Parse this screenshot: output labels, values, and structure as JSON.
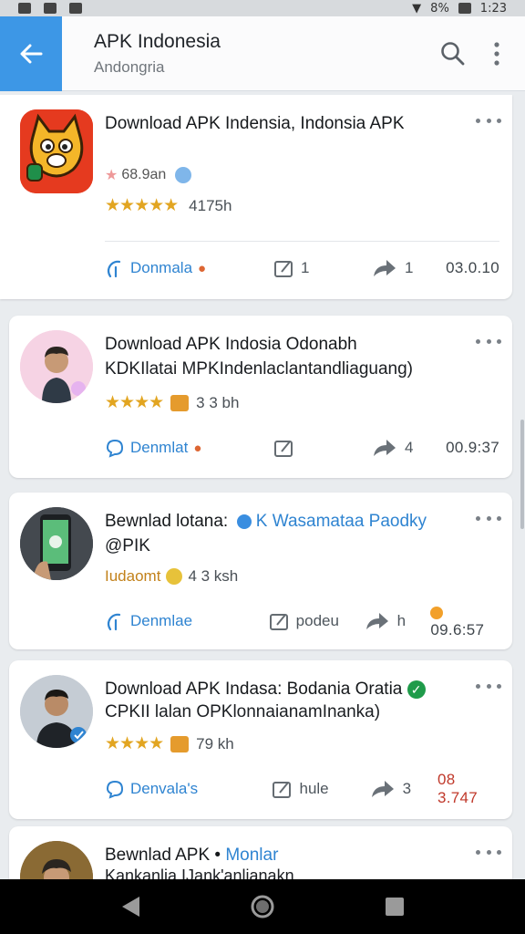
{
  "status": {
    "battery": "8%",
    "time": "1:23"
  },
  "appbar": {
    "title": "APK Indonesia",
    "subtitle": "Andongria"
  },
  "cards": [
    {
      "title": "Download APK Indensia, Indonsia APK",
      "meta": "68.9an",
      "rating_value": "4175h",
      "download_label": "Donmala",
      "comment_count": "1",
      "share_count": "1",
      "time": "03.0.10"
    },
    {
      "title": "Download APK Indosia Odonabh",
      "subtitle": "KDKIlatai MPKIndenlaclantandliaguang)",
      "rating_value": "3 3 bh",
      "download_label": "Denmlat",
      "comment_count": "",
      "share_count": "4",
      "time": "00.9:37"
    },
    {
      "title": "Bewnlad lotana:",
      "title_link": "K Wasamataa Paodky",
      "subtitle": "@PIK",
      "rating_text": "Iudaomt",
      "rating_value": "4 3 ksh",
      "download_label": "Denmlae",
      "comment_count": "podeu",
      "share_count": "h",
      "time": "09.6:57"
    },
    {
      "title": "Download APK Indasa: Bodania Oratia",
      "subtitle": "CPKII lalan OPKlonnaianamInanka)",
      "rating_value": "79 kh",
      "download_label": "Denvala's",
      "comment_count": "hule",
      "share_count": "3",
      "time": "08 3.747"
    },
    {
      "title": "Bewnlad APK •",
      "title_link": "Monlar",
      "subtitle": "Kankanlia IJank'anlianakn"
    }
  ],
  "colors": {
    "accent": "#3d97e6",
    "link": "#2f84d1",
    "star": "#e2a521",
    "verified": "#1f9b4a"
  }
}
